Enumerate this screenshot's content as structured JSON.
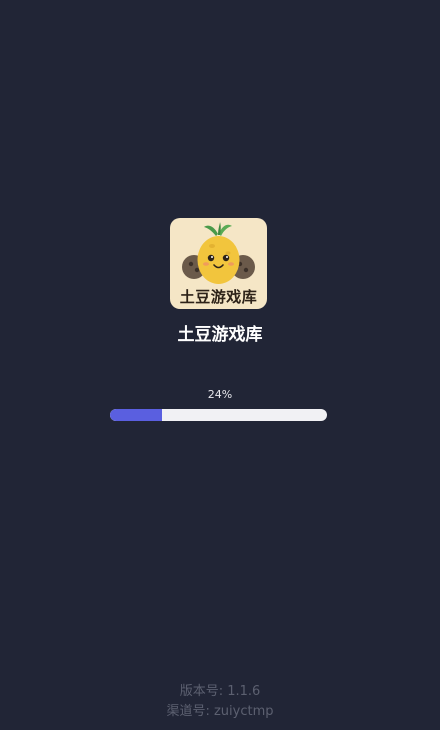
{
  "app": {
    "name": "土豆游戏库",
    "icon_caption": "土豆游戏库"
  },
  "progress": {
    "label": "24%",
    "fraction": 0.24
  },
  "footer": {
    "version": "版本号: 1.1.6",
    "channel": "渠道号: zuiyctmp"
  },
  "colors": {
    "background": "#212536",
    "progress_fill": "#5a5fe0",
    "progress_track": "#f1f1f4",
    "icon_background": "#f5e6c6"
  }
}
